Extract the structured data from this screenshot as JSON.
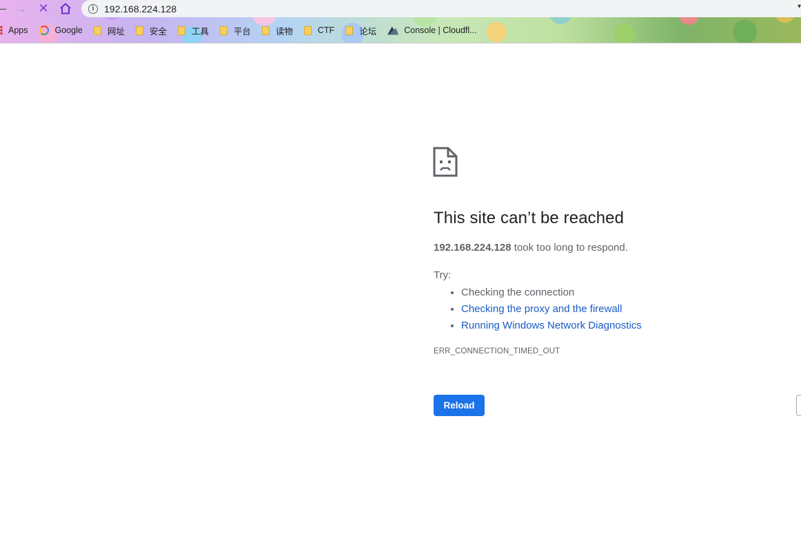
{
  "browser": {
    "nav": {
      "back_icon": "minus-icon",
      "forward_icon": "arrow-right-icon",
      "stop_icon": "close-icon",
      "home_icon": "home-icon"
    },
    "address": {
      "url": "192.168.224.128",
      "info_icon": "info-icon"
    },
    "bookmarks": [
      {
        "label": "Apps",
        "icon": "apps-grid-icon"
      },
      {
        "label": "Google",
        "icon": "google-icon"
      },
      {
        "label": "网址",
        "icon": "folder-icon"
      },
      {
        "label": "安全",
        "icon": "folder-icon"
      },
      {
        "label": "工具",
        "icon": "folder-icon"
      },
      {
        "label": "平台",
        "icon": "folder-icon"
      },
      {
        "label": "读物",
        "icon": "folder-icon"
      },
      {
        "label": "CTF",
        "icon": "folder-icon"
      },
      {
        "label": "论坛",
        "icon": "folder-icon"
      },
      {
        "label": "Console | Cloudfl...",
        "icon": "cloudflare-icon"
      }
    ]
  },
  "error": {
    "icon": "sad-document-icon",
    "title": "This site can’t be reached",
    "host": "192.168.224.128",
    "summary_suffix": " took too long to respond.",
    "try_label": "Try:",
    "suggestions": [
      {
        "text": "Checking the connection",
        "link": false
      },
      {
        "text": "Checking the proxy and the firewall",
        "link": true
      },
      {
        "text": "Running Windows Network Diagnostics",
        "link": true
      }
    ],
    "code": "ERR_CONNECTION_TIMED_OUT",
    "reload_label": "Reload"
  },
  "colors": {
    "primary_button": "#1a73e8",
    "link": "#1a5bc4",
    "secondary_text": "#5f6368",
    "title_text": "#202124"
  }
}
